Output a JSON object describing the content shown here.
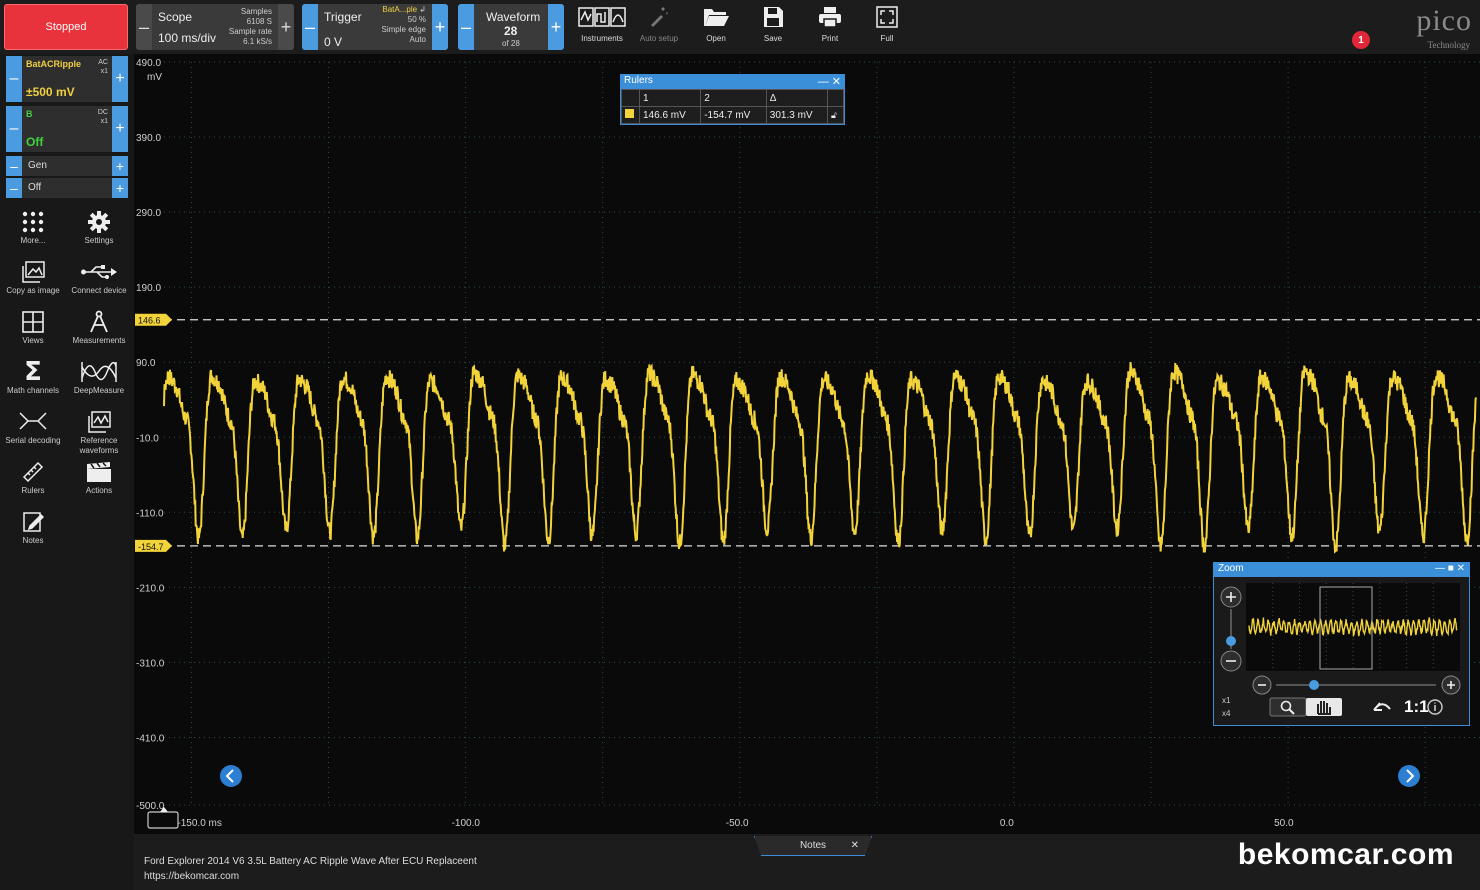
{
  "toolbar": {
    "run_state": "Stopped",
    "scope": {
      "label": "Scope",
      "timebase": "100 ms/div",
      "samples_label": "Samples",
      "samples_value": "6108 S",
      "rate_label": "Sample rate",
      "rate_value": "6.1 kS/s"
    },
    "trigger": {
      "label": "Trigger",
      "level": "0 V",
      "source": "BatA...ple",
      "percent": "50 %",
      "type": "Simple edge",
      "mode": "Auto"
    },
    "waveform": {
      "label": "Waveform",
      "number": "28",
      "of": "of 28"
    },
    "tools": [
      {
        "label": "Instruments",
        "icon": "instruments-icon"
      },
      {
        "label": "Auto setup",
        "icon": "auto-setup-icon"
      },
      {
        "label": "Open",
        "icon": "folder-open-icon"
      },
      {
        "label": "Save",
        "icon": "save-icon"
      },
      {
        "label": "Print",
        "icon": "print-icon"
      },
      {
        "label": "Full",
        "icon": "fullscreen-icon"
      }
    ],
    "alert_count": "1",
    "logo_main": "pico",
    "logo_sub": "Technology"
  },
  "channels": [
    {
      "name": "BatACRipple",
      "coupling": "AC",
      "probe": "x1",
      "range": "±500 mV",
      "name_color": "#f0d040",
      "range_color": "#f0d040"
    },
    {
      "name": "B",
      "coupling": "DC",
      "probe": "x1",
      "range": "Off",
      "name_color": "#40d040",
      "range_color": "#40d040"
    }
  ],
  "generator": {
    "label": "Gen",
    "state": "Off"
  },
  "sidebar_tools": [
    {
      "label": "More...",
      "icon": "grid-dots-icon"
    },
    {
      "label": "Settings",
      "icon": "gear-icon"
    },
    {
      "label": "Copy as image",
      "icon": "image-icon"
    },
    {
      "label": "Connect device",
      "icon": "usb-icon"
    },
    {
      "label": "Views",
      "icon": "views-grid-icon"
    },
    {
      "label": "Measurements",
      "icon": "compass-icon"
    },
    {
      "label": "Math channels",
      "icon": "sigma-icon"
    },
    {
      "label": "DeepMeasure",
      "icon": "deepmeasure-icon"
    },
    {
      "label": "Serial decoding",
      "icon": "serial-decoding-icon"
    },
    {
      "label": "Reference waveforms",
      "icon": "reference-waveforms-icon"
    },
    {
      "label": "Rulers",
      "icon": "ruler-icon"
    },
    {
      "label": "Actions",
      "icon": "clapper-icon"
    },
    {
      "label": "Notes",
      "icon": "notes-icon"
    }
  ],
  "plot": {
    "y_unit": "mV",
    "y_ticks": [
      "490.0",
      "390.0",
      "290.0",
      "190.0",
      "90.0",
      "-10.0",
      "-110.0",
      "-210.0",
      "-310.0",
      "-410.0",
      "-500.0"
    ],
    "x_ticks": [
      "-150.0 ms",
      "-100.0",
      "-50.0",
      "0.0",
      "50.0"
    ],
    "ruler_markers": [
      "146.6",
      "-154.7"
    ],
    "trace_color": "#f2d43a"
  },
  "chart_data": {
    "type": "line",
    "ylabel": "mV",
    "ylim": [
      -500,
      490
    ],
    "xlim_ms": [
      -155,
      85
    ],
    "ruler_levels": [
      146.6,
      -154.7
    ],
    "cycles": 30,
    "peak_mV": 146.6,
    "trough_mV": -154.7
  },
  "rulers_window": {
    "title": "Rulers",
    "headers": [
      "1",
      "2",
      "Δ"
    ],
    "values": [
      "146.6 mV",
      "-154.7 mV",
      "301.3 mV"
    ]
  },
  "zoom_window": {
    "title": "Zoom",
    "ratio": "1:1",
    "x1": "x1",
    "x4": "x4"
  },
  "bottom": {
    "notes_tab": "Notes",
    "note_line1": "Ford Explorer 2014 V6 3.5L Battery AC Ripple Wave After ECU Replaceent",
    "note_line2": "https://bekomcar.com",
    "brand": "bekomcar.com"
  }
}
